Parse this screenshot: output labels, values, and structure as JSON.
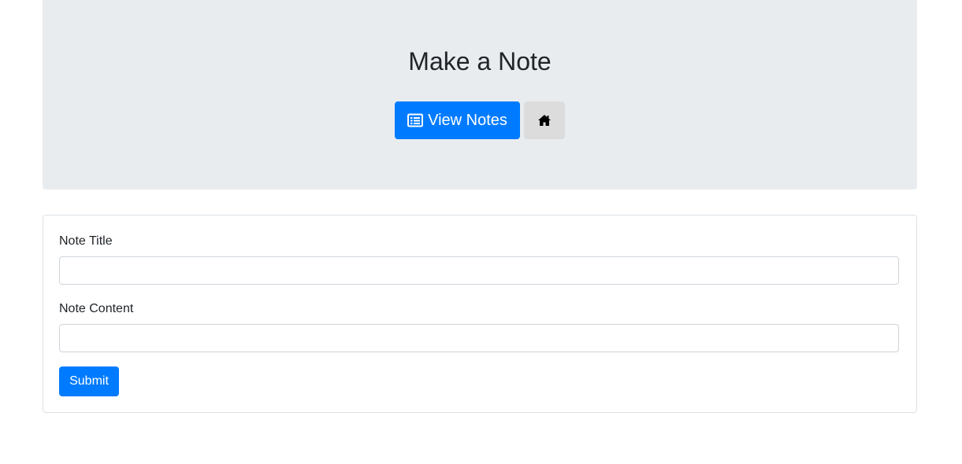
{
  "header": {
    "title": "Make a Note",
    "view_notes_label": "View Notes",
    "view_notes_icon": "list-alt-icon",
    "home_icon": "home-icon",
    "background_color": "#e9ecef"
  },
  "form": {
    "title_label": "Note Title",
    "title_value": "",
    "content_label": "Note Content",
    "content_value": "",
    "submit_label": "Submit"
  },
  "colors": {
    "primary": "#007bff",
    "secondary_button": "#dcdcdc"
  }
}
